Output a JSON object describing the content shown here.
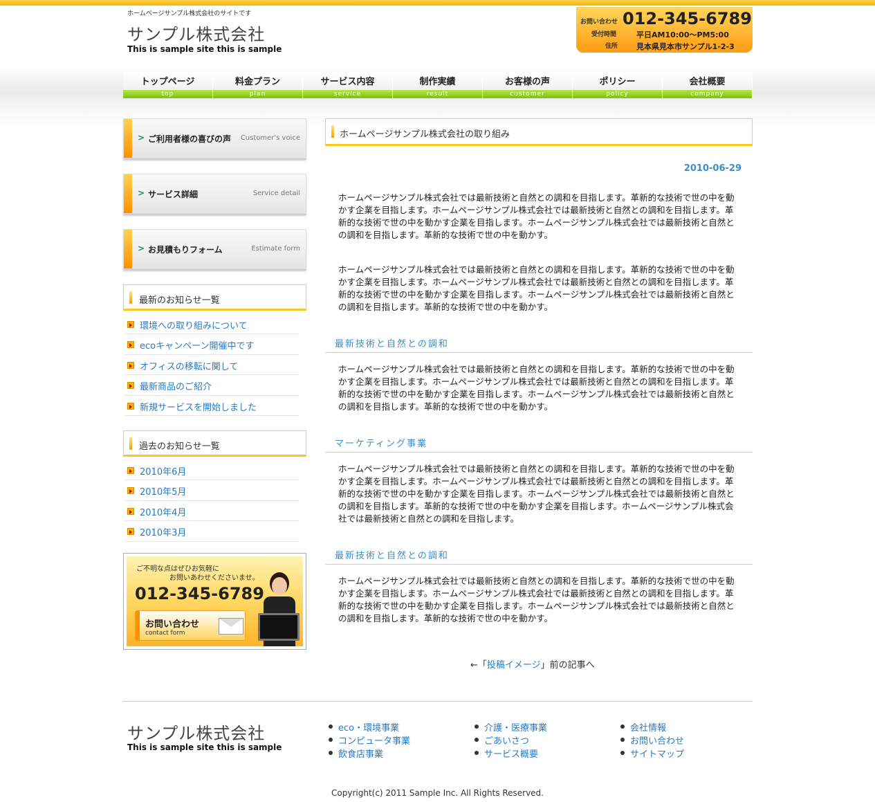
{
  "header": {
    "tagline": "ホームページサンプル株式会社のサイトです",
    "logo_jp": "サンプル株式会社",
    "logo_en": "This is sample site this is sample",
    "contact": {
      "label_inquiry": "お問い合わせ",
      "tel": "012-345-6789",
      "label_hours": "受付時間",
      "hours": "平日AM10:00〜PM5:00",
      "label_address": "住所",
      "address": "見本県見本市サンプル1-2-3"
    }
  },
  "nav": [
    {
      "jp": "トップページ",
      "en": "top"
    },
    {
      "jp": "料金プラン",
      "en": "plan"
    },
    {
      "jp": "サービス内容",
      "en": "service"
    },
    {
      "jp": "制作実績",
      "en": "result"
    },
    {
      "jp": "お客様の声",
      "en": "customer"
    },
    {
      "jp": "ポリシー",
      "en": "policy"
    },
    {
      "jp": "会社概要",
      "en": "company"
    }
  ],
  "sidebar": {
    "banners": [
      {
        "jp": "ご利用者様の喜びの声",
        "en": "Customer's voice"
      },
      {
        "jp": "サービス詳細",
        "en": "Service detail"
      },
      {
        "jp": "お見積もりフォーム",
        "en": "Estimate form"
      }
    ],
    "news_title": "最新のお知らせ一覧",
    "news": [
      "環境への取り組みについて",
      "ecoキャンペーン開催中です",
      "オフィスの移転に関して",
      "最新商品のご紹介",
      "新規サービスを開始しました"
    ],
    "archive_title": "過去のお知らせ一覧",
    "archive": [
      "2010年6月",
      "2010年5月",
      "2010年4月",
      "2010年3月"
    ],
    "contact": {
      "msg1": "ご不明な点はぜひお気軽に",
      "msg2": "お問いあわせくださいませ。",
      "tel": "012-345-6789",
      "btn_jp": "お問い合わせ",
      "btn_en": "contact form"
    }
  },
  "main": {
    "title": "ホームページサンプル株式会社の取り組み",
    "date": "2010-06-29",
    "p1": "ホームページサンプル株式会社では最新技術と自然との調和を目指します。革新的な技術で世の中を動かす企業を目指します。ホームページサンプル株式会社では最新技術と自然との調和を目指します。革新的な技術で世の中を動かす企業を目指します。ホームページサンプル株式会社では最新技術と自然との調和を目指します。革新的な技術で世の中を動かす。",
    "p2": "ホームページサンプル株式会社では最新技術と自然との調和を目指します。革新的な技術で世の中を動かす企業を目指します。ホームページサンプル株式会社では最新技術と自然との調和を目指します。革新的な技術で世の中を動かす企業を目指します。ホームページサンプル株式会社では最新技術と自然との調和を目指します。革新的な技術で世の中を動かす。",
    "h1": "最新技術と自然との調和",
    "p3": "ホームページサンプル株式会社では最新技術と自然との調和を目指します。革新的な技術で世の中を動かす企業を目指します。ホームページサンプル株式会社では最新技術と自然との調和を目指します。革新的な技術で世の中を動かす企業を目指します。ホームページサンプル株式会社では最新技術と自然との調和を目指します。革新的な技術で世の中を動かす。",
    "h2": "マーケティング事業",
    "p4": "ホームページサンプル株式会社では最新技術と自然との調和を目指します。革新的な技術で世の中を動かす企業を目指します。ホームページサンプル株式会社では最新技術と自然との調和を目指します。革新的な技術で世の中を動かす企業を目指します。ホームページサンプル株式会社では最新技術と自然との調和を目指します。革新的な技術で世の中を動かす企業を目指します。ホームページサンプル株式会社では最新技術と自然との調和を目指します。",
    "h3": "最新技術と自然との調和",
    "p5": "ホームページサンプル株式会社では最新技術と自然との調和を目指します。革新的な技術で世の中を動かす企業を目指します。ホームページサンプル株式会社では最新技術と自然との調和を目指します。革新的な技術で世の中を動かす企業を目指します。ホームページサンプル株式会社では最新技術と自然との調和を目指します。革新的な技術で世の中を動かす。",
    "prev_prefix": "←「",
    "prev_link": "投稿イメージ",
    "prev_suffix": "」前の記事へ"
  },
  "footer": {
    "logo_jp": "サンプル株式会社",
    "logo_en": "This is sample site this is sample",
    "col1": [
      "eco・環境事業",
      "コンピュータ事業",
      "飲食店事業"
    ],
    "col2": [
      "介護・医療事業",
      "ごあいさつ",
      "サービス概要"
    ],
    "col3": [
      "会社情報",
      "お問い合わせ",
      "サイトマップ"
    ],
    "copyright": "Copyright(c) 2011 Sample Inc. All Rights Reserved."
  }
}
